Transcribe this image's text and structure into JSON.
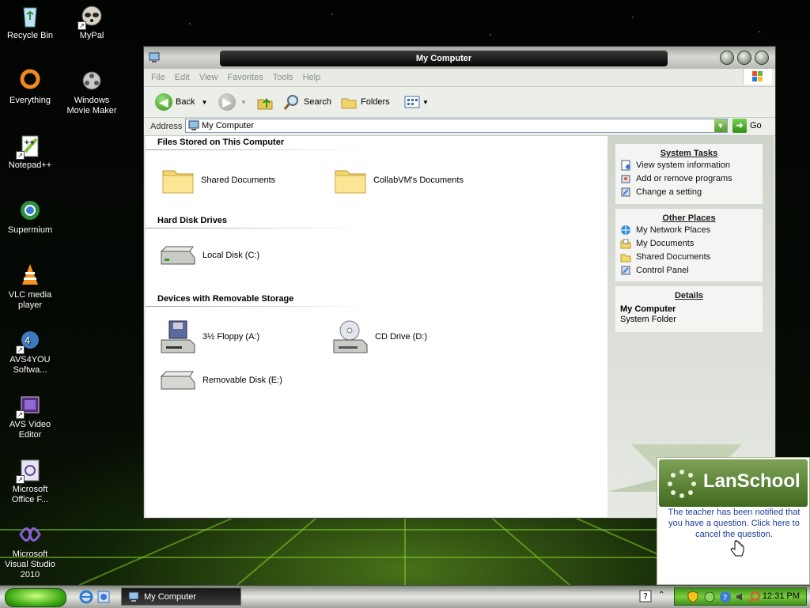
{
  "desktop": {
    "icons": [
      {
        "label": "Recycle Bin"
      },
      {
        "label": "MyPal"
      },
      {
        "label": "Everything"
      },
      {
        "label": "Windows Movie Maker"
      },
      {
        "label": "Notepad++"
      },
      {
        "label": "Supermium"
      },
      {
        "label": "VLC media player"
      },
      {
        "label": "AVS4YOU Softwa..."
      },
      {
        "label": "AVS Video Editor"
      },
      {
        "label": "Microsoft Office F..."
      },
      {
        "label": "Microsoft Visual Studio 2010"
      }
    ]
  },
  "window": {
    "title": "My Computer",
    "menu": [
      "File",
      "Edit",
      "View",
      "Favorites",
      "Tools",
      "Help"
    ],
    "toolbar": {
      "back": "Back",
      "search": "Search",
      "folders": "Folders"
    },
    "address": {
      "label": "Address",
      "value": "My Computer",
      "go": "Go"
    },
    "groups": {
      "files": {
        "heading": "Files Stored on This Computer",
        "items": [
          "Shared Documents",
          "CollabVM's Documents"
        ]
      },
      "drives": {
        "heading": "Hard Disk Drives",
        "items": [
          "Local Disk (C:)"
        ]
      },
      "removable": {
        "heading": "Devices with Removable Storage",
        "items": [
          "3½ Floppy (A:)",
          "CD Drive (D:)",
          "Removable Disk (E:)"
        ]
      }
    },
    "tasks": {
      "system": {
        "heading": "System Tasks",
        "items": [
          "View system information",
          "Add or remove programs",
          "Change a setting"
        ]
      },
      "places": {
        "heading": "Other Places",
        "items": [
          "My Network Places",
          "My Documents",
          "Shared Documents",
          "Control Panel"
        ]
      },
      "details": {
        "heading": "Details",
        "name": "My Computer",
        "type": "System Folder"
      }
    }
  },
  "lanschool": {
    "title": "LanSchool",
    "message": "The teacher has been notified that you have a question. Click here to cancel the question."
  },
  "taskbar": {
    "task_label": "My Computer",
    "clock": "12:31 PM"
  },
  "colors": {
    "accent": "#4f9a2a",
    "link": "#1c3e9c"
  }
}
